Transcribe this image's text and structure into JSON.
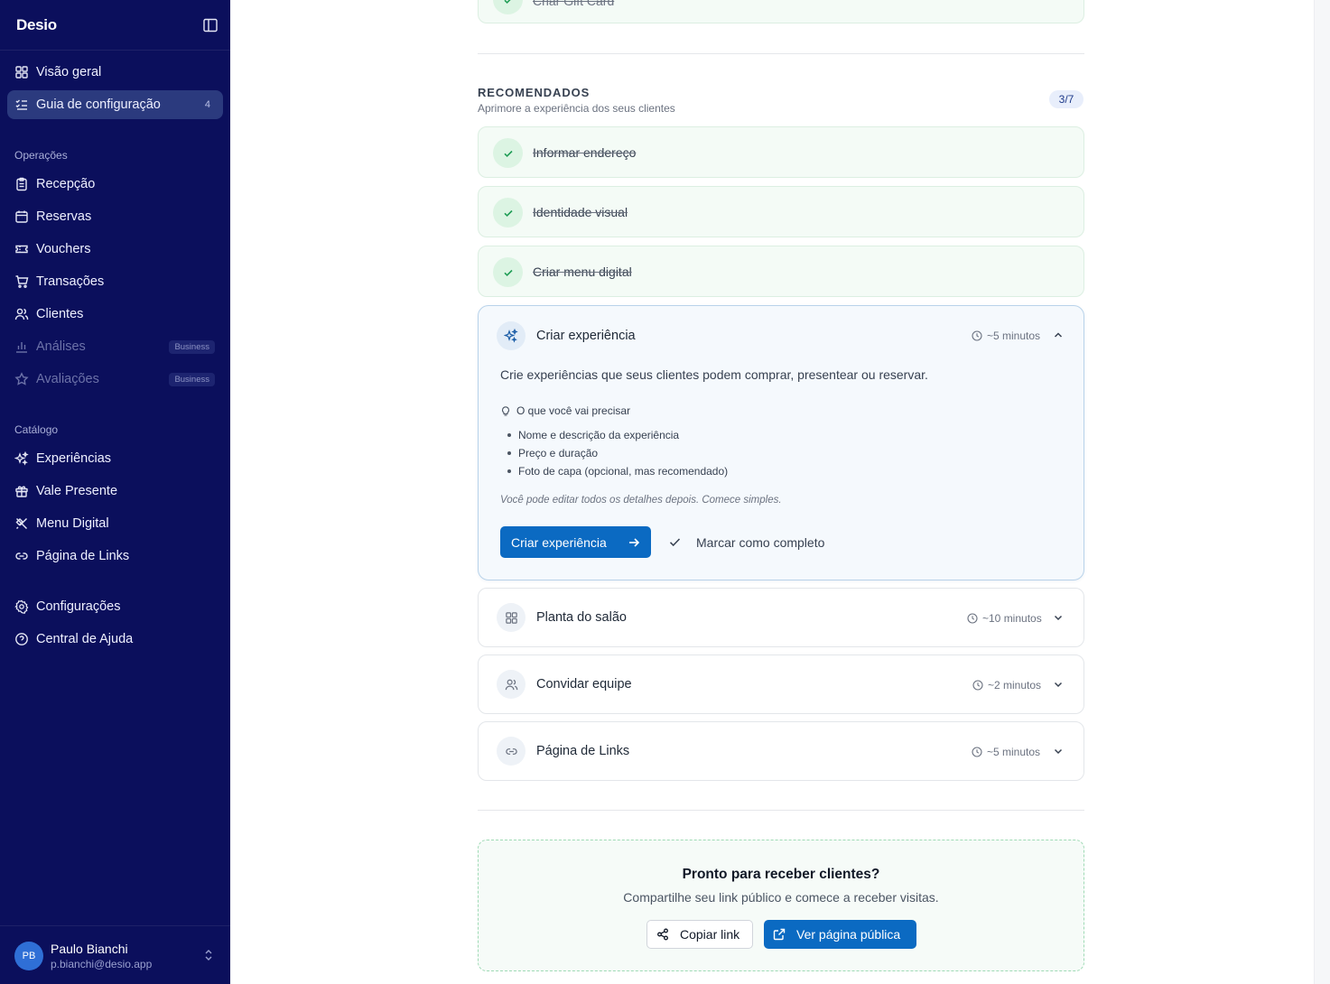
{
  "sidebar": {
    "brand": "Desio",
    "nav_top": [
      {
        "label": "Visão geral",
        "icon": "grid-icon"
      },
      {
        "label": "Guia de configuração",
        "icon": "checklist-icon",
        "count": "4",
        "active": true
      }
    ],
    "sections": {
      "operacoes": "Operações",
      "catalogo": "Catálogo"
    },
    "operacoes": [
      {
        "label": "Recepção",
        "icon": "clipboard-icon"
      },
      {
        "label": "Reservas",
        "icon": "calendar-icon"
      },
      {
        "label": "Vouchers",
        "icon": "ticket-icon"
      },
      {
        "label": "Transações",
        "icon": "cart-icon"
      },
      {
        "label": "Clientes",
        "icon": "users-icon"
      },
      {
        "label": "Análises",
        "icon": "bar-chart-icon",
        "tag": "Business",
        "disabled": true
      },
      {
        "label": "Avaliações",
        "icon": "star-icon",
        "tag": "Business",
        "disabled": true
      }
    ],
    "catalogo": [
      {
        "label": "Experiências",
        "icon": "sparkles-icon"
      },
      {
        "label": "Vale Presente",
        "icon": "gift-icon"
      },
      {
        "label": "Menu Digital",
        "icon": "utensils-icon"
      },
      {
        "label": "Página de Links",
        "icon": "link-icon"
      }
    ],
    "bottom": [
      {
        "label": "Configurações",
        "icon": "gear-icon"
      },
      {
        "label": "Central de Ajuda",
        "icon": "help-icon"
      }
    ],
    "user": {
      "initials": "PB",
      "name": "Paulo Bianchi",
      "email": "p.bianchi@desio.app"
    }
  },
  "main": {
    "top_done_label": "Criar Gift Card",
    "recommended": {
      "title": "RECOMENDADOS",
      "subtitle": "Aprimore a experiência dos seus clientes",
      "progress": "3/7",
      "done": [
        "Informar endereço",
        "Identidade visual",
        "Criar menu digital"
      ],
      "expanded": {
        "title": "Criar experiência",
        "time": "~5 minutos",
        "description": "Crie experiências que seus clientes podem comprar, presentear ou reservar.",
        "need_title": "O que você vai precisar",
        "needs": [
          "Nome e descrição da experiência",
          "Preço e duração",
          "Foto de capa (opcional, mas recomendado)"
        ],
        "note": "Você pode editar todos os detalhes depois. Comece simples.",
        "primary_label": "Criar experiência",
        "mark_label": "Marcar como completo"
      },
      "todo": [
        {
          "label": "Planta do salão",
          "time": "~10 minutos",
          "icon": "layout-grid-icon"
        },
        {
          "label": "Convidar equipe",
          "time": "~2 minutos",
          "icon": "users-icon"
        },
        {
          "label": "Página de Links",
          "time": "~5 minutos",
          "icon": "link-icon"
        }
      ]
    },
    "cta": {
      "title": "Pronto para receber clientes?",
      "subtitle": "Compartilhe seu link público e comece a receber visitas.",
      "copy_label": "Copiar link",
      "view_label": "Ver página pública"
    }
  },
  "colors": {
    "sidebar_bg": "#0b0f5c",
    "active_item": "#2b3a7e",
    "primary": "#0b6ac2",
    "done_bg": "#f4fbf6",
    "check_green": "#1f9d55"
  }
}
